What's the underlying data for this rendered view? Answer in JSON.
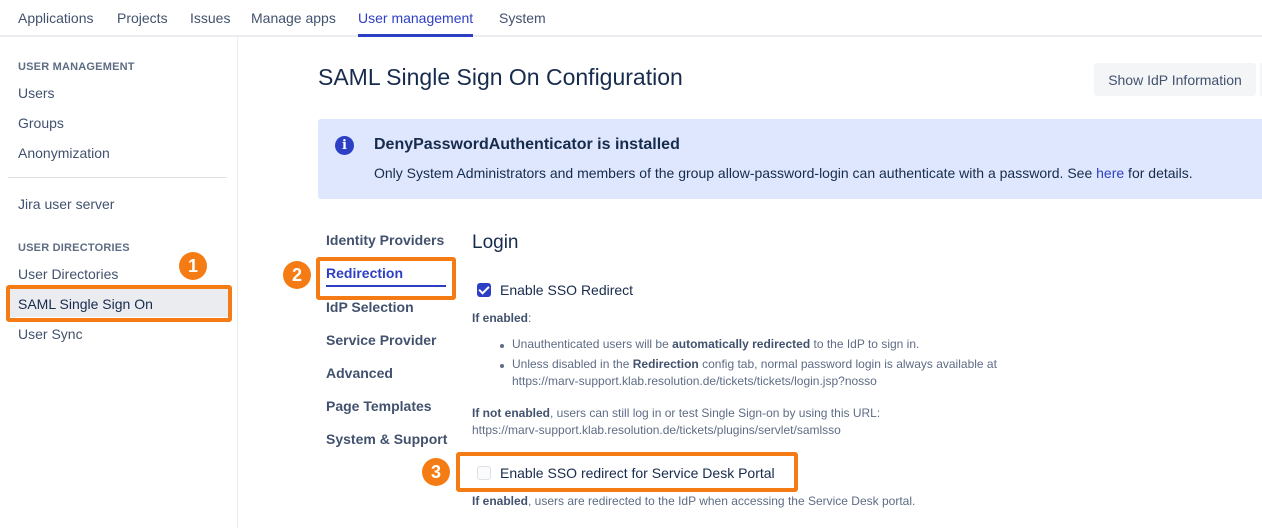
{
  "topnav": {
    "tabs": [
      {
        "label": "Applications",
        "active": false
      },
      {
        "label": "Projects",
        "active": false
      },
      {
        "label": "Issues",
        "active": false
      },
      {
        "label": "Manage apps",
        "active": false
      },
      {
        "label": "User management",
        "active": true
      },
      {
        "label": "System",
        "active": false
      }
    ]
  },
  "sidebar": {
    "section1_heading": "USER MANAGEMENT",
    "section1_items": [
      "Users",
      "Groups",
      "Anonymization"
    ],
    "standalone_item": "Jira user server",
    "section2_heading": "USER DIRECTORIES",
    "section2_items": [
      "User Directories",
      "SAML Single Sign On",
      "User Sync"
    ],
    "selected": "SAML Single Sign On"
  },
  "annotations": {
    "badge1": "1",
    "badge2": "2",
    "badge3": "3",
    "color": "#f57c14"
  },
  "main": {
    "title": "SAML Single Sign On Configuration",
    "show_idp_button": "Show IdP Information",
    "info": {
      "title": "DenyPasswordAuthenticator is installed",
      "body_before": "Only System Administrators and members of the group allow-password-login can authenticate with a password. See ",
      "link": "here",
      "body_after": " for details."
    },
    "config_tabs": [
      "Identity Providers",
      "Redirection",
      "IdP Selection",
      "Service Provider",
      "Advanced",
      "Page Templates",
      "System & Support"
    ],
    "active_config_tab": "Redirection",
    "section_title": "Login",
    "sso_redirect": {
      "label": "Enable SSO Redirect",
      "checked": true,
      "if_enabled_label": "If enabled",
      "if_enabled_colon": ":",
      "bullet1_before": "Unauthenticated users will be ",
      "bullet1_bold": "automatically redirected",
      "bullet1_after": " to the IdP to sign in.",
      "bullet2_before": "Unless disabled in the ",
      "bullet2_bold": "Redirection",
      "bullet2_after": " config tab, normal password login is always available at",
      "bullet2_url": "https://marv-support.klab.resolution.de/tickets/tickets/login.jsp?nosso",
      "not_enabled_bold": "If not enabled",
      "not_enabled_text": ", users can still log in or test Single Sign-on by using this URL:",
      "not_enabled_url": "https://marv-support.klab.resolution.de/tickets/plugins/servlet/samlsso"
    },
    "sd_redirect": {
      "label": "Enable SSO redirect for Service Desk Portal",
      "checked": false,
      "help_bold": "If enabled",
      "help_text": ", users are redirected to the IdP when accessing the Service Desk portal."
    }
  }
}
